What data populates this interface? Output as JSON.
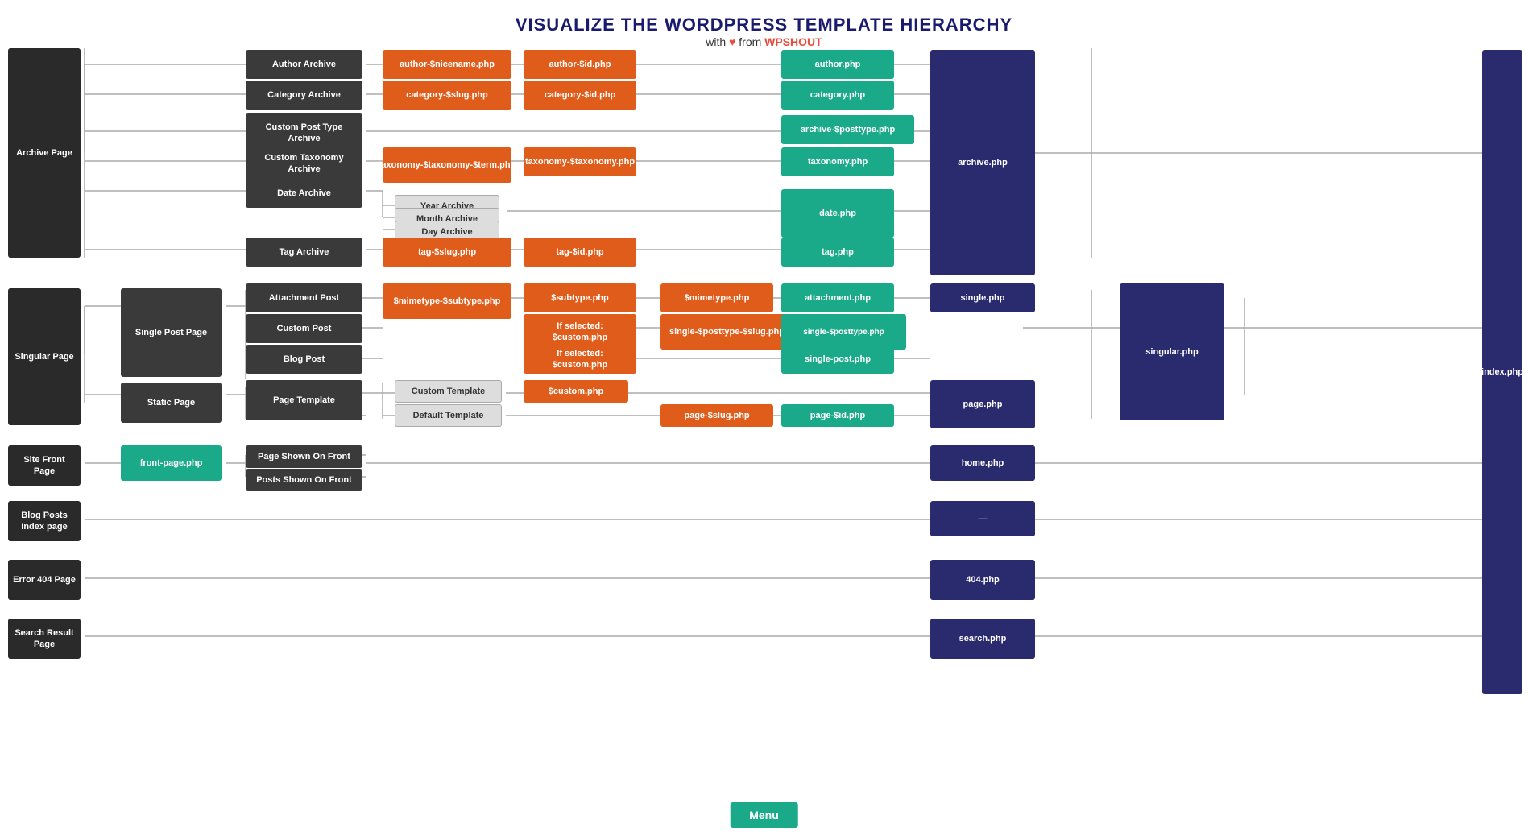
{
  "title": "VISUALIZE THE WORDPRESS TEMPLATE HIERARCHY",
  "subtitle": {
    "with": "with",
    "heart": "♥",
    "from": "from",
    "brand": "WPSHOUT"
  },
  "nodes": {
    "archive_page": "Archive Page",
    "singular_page": "Singular Page",
    "site_front_page": "Site Front Page",
    "blog_posts_index_page": "Blog Posts Index page",
    "error_404_page": "Error 404 Page",
    "search_result_page": "Search Result Page",
    "single_post_page": "Single Post Page",
    "static_page": "Static Page",
    "front_page_php": "front-page.php",
    "author_archive": "Author Archive",
    "category_archive": "Category Archive",
    "custom_post_type_archive": "Custom Post Type Archive",
    "custom_taxonomy_archive": "Custom Taxonomy Archive",
    "date_archive": "Date Archive",
    "tag_archive": "Tag Archive",
    "year_archive": "Year Archive",
    "month_archive": "Month Archive",
    "day_archive": "Day Archive",
    "attachment_post": "Attachment Post",
    "custom_post": "Custom Post",
    "blog_post": "Blog Post",
    "page_template": "Page Template",
    "page_shown_on_front": "Page Shown On Front",
    "posts_shown_on_front": "Posts Shown On Front",
    "custom_template": "Custom Template",
    "default_template": "Default Template",
    "author_nicename_php": "author-$nicename.php",
    "author_id_php": "author-$id.php",
    "author_php": "author.php",
    "archive_php": "archive.php",
    "index_php": "index.php",
    "category_slug_php": "category-$slug.php",
    "category_id_php": "category-$id.php",
    "category_php": "category.php",
    "archive_posttype_php": "archive-$posttype.php",
    "taxonomy_taxonomy_term_php": "taxonomy-$taxonomy-$term.php",
    "taxonomy_taxonomy_php": "taxonomy-$taxonomy.php",
    "taxonomy_php": "taxonomy.php",
    "date_php": "date.php",
    "tag_slug_php": "tag-$slug.php",
    "tag_id_php": "tag-$id.php",
    "tag_php": "tag.php",
    "mimetype_subtype_php": "$mimetype-$subtype.php",
    "subtype_php": "$subtype.php",
    "mimetype_php": "$mimetype.php",
    "attachment_php": "attachment.php",
    "single_php": "single.php",
    "singular_php": "singular.php",
    "if_selected_custom_php_1": "If selected: $custom.php",
    "single_posttype_slug_php": "single-$posttype-$slug.php",
    "if_selected_custom_php_2": "If selected: $custom.php",
    "single_post_php": "single-post.php",
    "custom_php": "$custom.php",
    "page_slug_php": "page-$slug.php",
    "page_id_php": "page-$id.php",
    "page_php": "page.php",
    "home_php": "home.php",
    "404_php": "404.php",
    "search_php": "search.php",
    "menu": "Menu"
  }
}
